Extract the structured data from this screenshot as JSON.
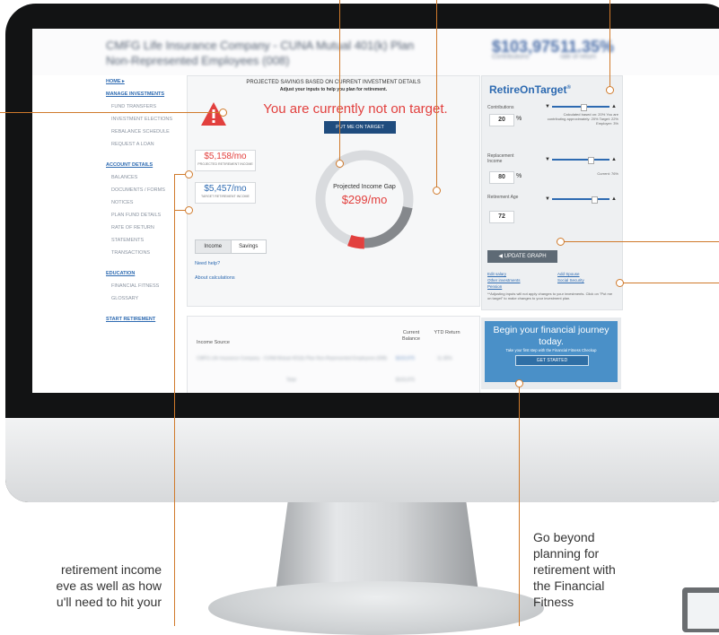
{
  "header": {
    "company": "CMFG Life Insurance Company - CUNA Mutual 401(k) Plan Non-Represented Employees (008)",
    "balance": "$103,975",
    "balance_sub": "Contributions",
    "rate": "11.35%",
    "rate_sub": "rate of return"
  },
  "nav": {
    "home": "HOME ▸",
    "manage": "MANAGE INVESTMENTS",
    "manage_items": [
      "FUND TRANSFERS",
      "INVESTMENT ELECTIONS",
      "REBALANCE SCHEDULE",
      "REQUEST A LOAN"
    ],
    "account": "ACCOUNT DETAILS",
    "account_items": [
      "BALANCES",
      "DOCUMENTS / FORMS",
      "NOTICES",
      "PLAN FUND DETAILS",
      "RATE OF RETURN",
      "STATEMENTS",
      "TRANSACTIONS"
    ],
    "education": "EDUCATION",
    "education_items": [
      "FINANCIAL FITNESS",
      "GLOSSARY"
    ],
    "start": "START RETIREMENT"
  },
  "projection": {
    "title": "PROJECTED SAVINGS BASED ON CURRENT INVESTMENT DETAILS",
    "subtitle": "Adjust your inputs to help you plan for retirement.",
    "status": "You are currently not on target.",
    "put_me_button": "PUT ME ON TARGET",
    "projected_income": "$5,158/mo",
    "projected_income_label": "PROJECTED RETIREMENT INCOME",
    "target_income": "$5,457/mo",
    "target_income_label": "TARGET RETIREMENT INCOME",
    "gap_label": "Projected Income Gap",
    "gap_value": "$299/mo",
    "gap_fraction": 0.055,
    "toggle_income": "Income",
    "toggle_savings": "Savings",
    "need_help": "Need help?",
    "about_calc": "About calculations"
  },
  "table": {
    "col_source": "Income Source",
    "col_current": "Current Balance",
    "col_ytd": "YTD Return",
    "row": "CMFG Life Insurance Company - CUNA Mutual 401(k) Plan Non-Represented Employees (008)",
    "row_balance": "$103,975",
    "row_ytd": "11.35%",
    "total": "Total",
    "total_value": "$103,975"
  },
  "retire": {
    "title": "RetireOnTarget",
    "reg": "®",
    "contributions_label": "Contributions",
    "contributions_value": "20",
    "pct": "%",
    "contrib_note": "Calculated based on: 20% You are contributing approximately: 20% Target: 22% Employer: 3%",
    "replacement_label": "Replacement Income",
    "replacement_value": "80",
    "replacement_note": "Current: 76%",
    "age_label": "Retirement Age",
    "age_value": "72",
    "update_button": "◀ UPDATE GRAPH",
    "edit_salary": "Edit salary",
    "other_investments": "Other investments",
    "pension": "Pension",
    "add_spouse": "Add Spouse",
    "social_security": "Social Security",
    "footnote": "**Adjusting inputs will not apply changes to your investments. Click on \"Put me on target\" to make changes to your investment plan."
  },
  "begin": {
    "title": "Begin your financial journey today.",
    "sub": "Take your first step with the Financial Fitness Checkup",
    "button": "GET STARTED"
  },
  "callouts": {
    "left_text_lines": [
      "retirement income",
      "eve as well as how",
      "u'll need to hit your"
    ],
    "right_text_lines": [
      "Go beyond",
      "planning for",
      "retirement with",
      "the Financial",
      "Fitness"
    ]
  },
  "colors": {
    "accent": "#2d6ab1",
    "alert": "#e2403e",
    "callout": "#d07a2b"
  }
}
